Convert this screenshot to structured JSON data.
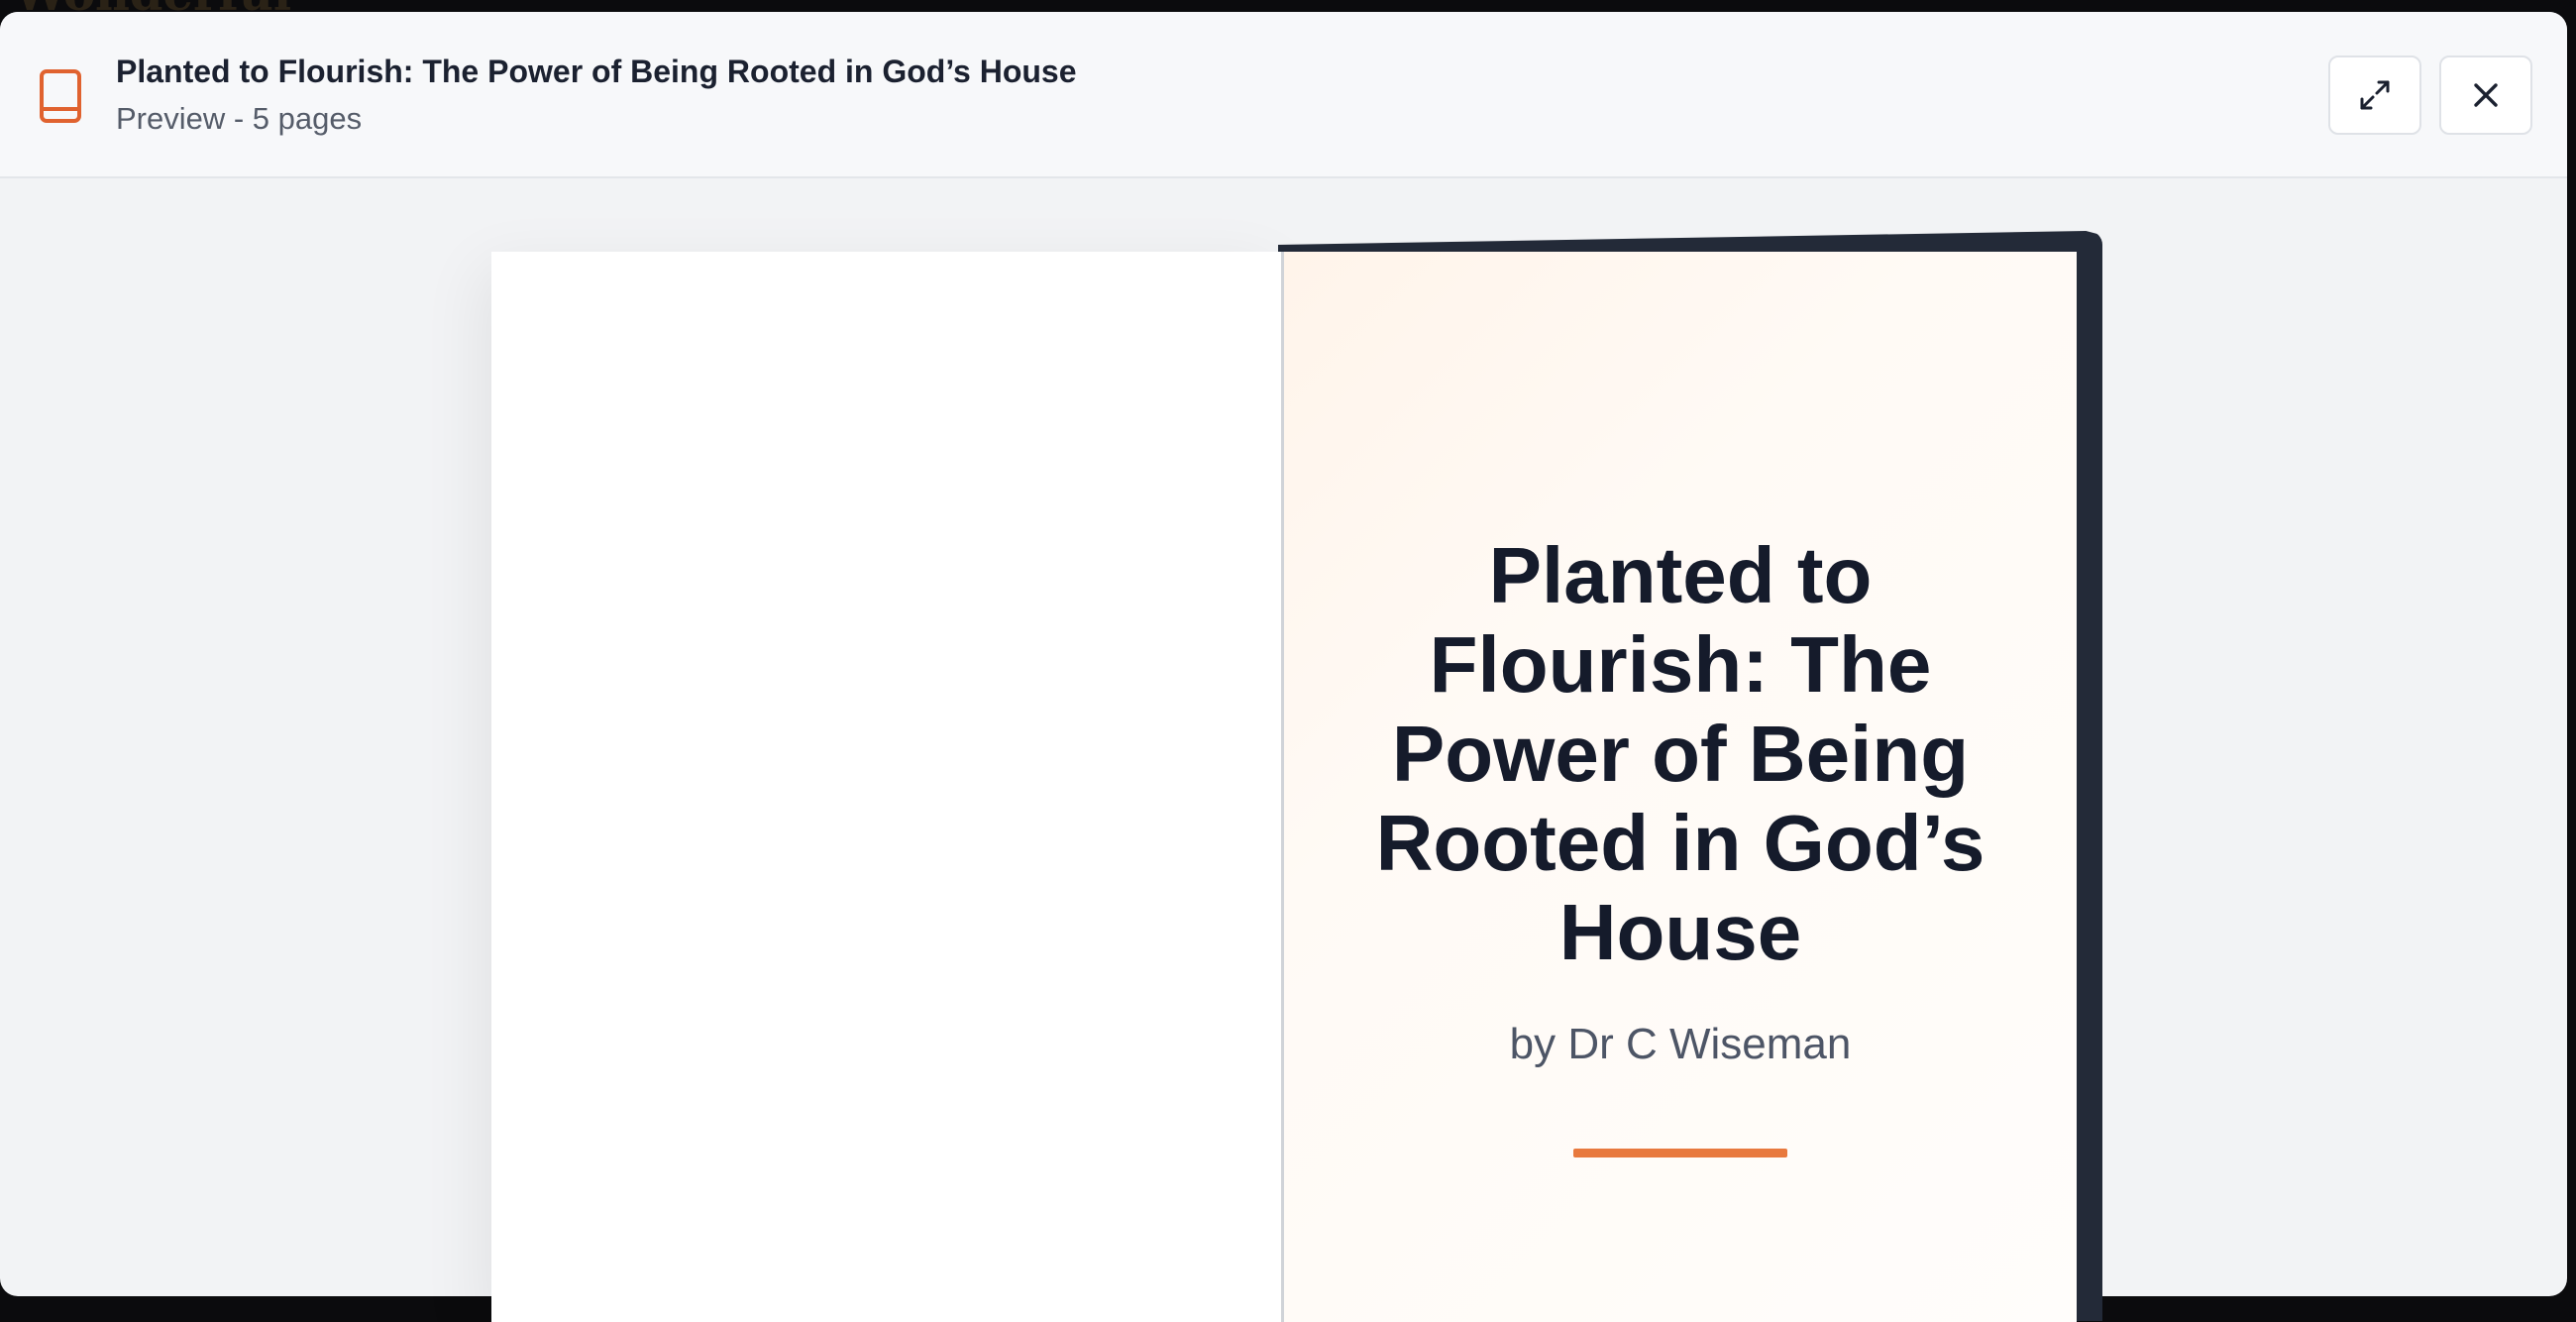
{
  "backdrop": {
    "text": "Wonderful"
  },
  "header": {
    "title": "Planted to Flourish: The Power of Being Rooted in God’s House",
    "subtitle": "Preview - 5 pages",
    "icon": "book-icon",
    "expand_icon": "expand-icon",
    "close_icon": "close-icon"
  },
  "cover": {
    "title": "Planted to Flourish: The Power of Being Rooted in God’s House",
    "author": "by Dr C Wiseman"
  },
  "colors": {
    "accent": "#e8793e",
    "icon": "#e0622f",
    "cover_text": "#151b2b",
    "book_back": "#232a38"
  }
}
